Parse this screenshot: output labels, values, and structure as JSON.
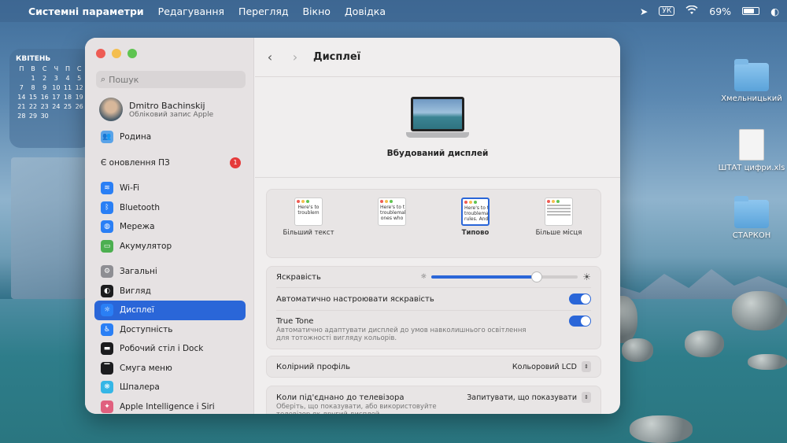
{
  "menubar": {
    "app_name": "Системні параметри",
    "items": [
      "Редагування",
      "Перегляд",
      "Вікно",
      "Довідка"
    ],
    "keyboard": "УК",
    "battery": "69%"
  },
  "calendar": {
    "month": "КВІТЕНЬ",
    "weekdays": [
      "П",
      "В",
      "С",
      "Ч",
      "П",
      "С"
    ],
    "rows": [
      [
        "",
        "1",
        "2",
        "3",
        "4",
        "5"
      ],
      [
        "7",
        "8",
        "9",
        "10",
        "11",
        "12"
      ],
      [
        "14",
        "15",
        "16",
        "17",
        "18",
        "19"
      ],
      [
        "21",
        "22",
        "23",
        "24",
        "25",
        "26"
      ],
      [
        "28",
        "29",
        "30",
        "",
        "",
        ""
      ]
    ]
  },
  "desktop": {
    "items": [
      {
        "label": "Хмельницький"
      },
      {
        "label": "ШТАТ цифри.xls"
      },
      {
        "label": "СТАРКОН"
      }
    ]
  },
  "sidebar": {
    "search_placeholder": "Пошук",
    "account_name": "Dmitro Bachinskij",
    "account_sub": "Обліковий запис Apple",
    "family": "Родина",
    "update_label": "Є оновлення ПЗ",
    "update_count": "1",
    "items": [
      {
        "label": "Wi-Fi",
        "icon": "wifi-icon",
        "color": "#2a7ff5"
      },
      {
        "label": "Bluetooth",
        "icon": "bluetooth-icon",
        "color": "#2a7ff5"
      },
      {
        "label": "Мережа",
        "icon": "globe-icon",
        "color": "#2a7ff5"
      },
      {
        "label": "Акумулятор",
        "icon": "battery-icon",
        "color": "#4caf50"
      },
      {
        "label": "Загальні",
        "icon": "gear-icon",
        "color": "#8e8e93"
      },
      {
        "label": "Вигляд",
        "icon": "appearance-icon",
        "color": "#1c1c1e"
      },
      {
        "label": "Дисплеї",
        "icon": "display-icon",
        "color": "#2a7ff5"
      },
      {
        "label": "Доступність",
        "icon": "accessibility-icon",
        "color": "#2a7ff5"
      },
      {
        "label": "Робочий стіл і Dock",
        "icon": "dock-icon",
        "color": "#1c1c1e"
      },
      {
        "label": "Смуга меню",
        "icon": "menubar-icon",
        "color": "#1c1c1e"
      },
      {
        "label": "Шпалера",
        "icon": "wallpaper-icon",
        "color": "#35b6e6"
      },
      {
        "label": "Apple Intelligence і Siri",
        "icon": "siri-icon",
        "color": "#e0607e"
      }
    ]
  },
  "main": {
    "title": "Дисплеї",
    "display_name": "Вбудований дисплей",
    "resolution": [
      {
        "label": "Більший текст",
        "preview": [
          "Here's to",
          "troublem"
        ]
      },
      {
        "label": "",
        "preview": [
          "Here's to t",
          "troublemak",
          "ones who"
        ]
      },
      {
        "label": "Типово",
        "preview": [
          "Here's to th",
          "troublemakers",
          "rules. And the"
        ]
      },
      {
        "label": "Більше місця",
        "preview": [
          "",
          "",
          "",
          ""
        ]
      }
    ],
    "brightness_label": "Яскравість",
    "brightness_level": 0.72,
    "auto_brightness_label": "Автоматично настроювати яскравість",
    "truetone_label": "True Tone",
    "truetone_sub": "Автоматично адаптувати дисплей до умов навколишнього освітлення для тотожності вигляду кольорів.",
    "color_profile_label": "Колірний профіль",
    "color_profile_value": "Кольоровий LCD",
    "tv_label": "Коли під'єднано до телевізора",
    "tv_sub": "Оберіть, що показувати, або використовуйте телевізор як другий дисплей",
    "tv_value": "Запитувати, що показувати"
  }
}
